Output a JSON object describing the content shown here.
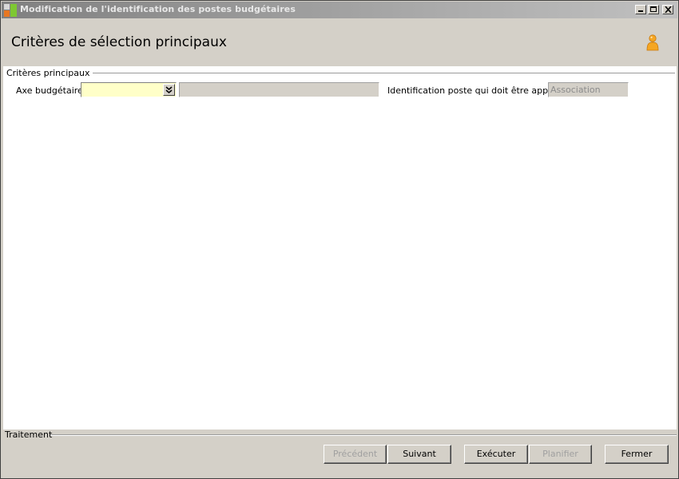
{
  "window": {
    "title": "Modification de l'identification des postes budgétaires"
  },
  "header": {
    "title": "Critères de sélection principaux"
  },
  "criteria": {
    "group_label": "Critères principaux",
    "axe_label": "Axe budgétaire :",
    "axe_value": "",
    "axe_description": "",
    "identification_label": "Identification poste qui doit être appliquée",
    "identification_value": "Association"
  },
  "footer": {
    "group_label": "Traitement",
    "buttons": {
      "precedent": "Précédent",
      "suivant": "Suivant",
      "executer": "Exécuter",
      "planifier": "Planifier",
      "fermer": "Fermer"
    }
  },
  "colors": {
    "required_field": "#ffffc8",
    "dialog_bg": "#d4d0c8",
    "user_icon": "#f5a623"
  },
  "icons": {
    "app": "app-icon",
    "user": "user-icon",
    "combo": "double-chevron-down-icon"
  }
}
